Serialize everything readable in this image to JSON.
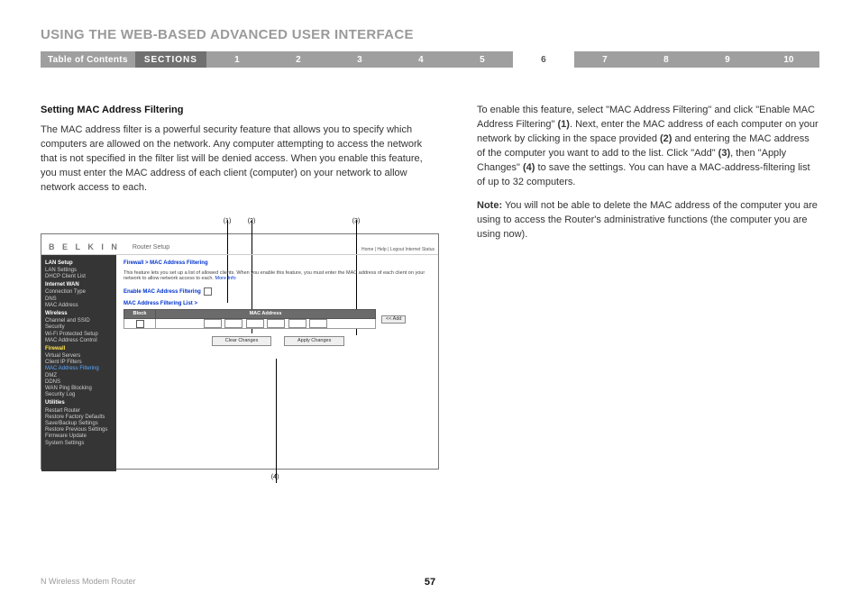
{
  "title": "USING THE WEB-BASED ADVANCED USER INTERFACE",
  "bar": {
    "toc": "Table of Contents",
    "sections": "SECTIONS",
    "nums": [
      "1",
      "2",
      "3",
      "4",
      "5",
      "6",
      "7",
      "8",
      "9",
      "10"
    ],
    "active": "6"
  },
  "left": {
    "heading": "Setting MAC Address Filtering",
    "p1": "The MAC address filter is a powerful security feature that allows you to specify which computers are allowed on the network. Any computer attempting to access the network that is not specified in the filter list will be denied access. When you enable this feature, you must enter the MAC address of each client (computer) on your network to allow network access to each."
  },
  "right": {
    "p1a": "To enable this feature, select \"MAC Address Filtering\" and click \"Enable MAC Address Filtering\" ",
    "b1": "(1)",
    "p1b": ". Next, enter the MAC address of each computer on your network by clicking in the space provided ",
    "b2": "(2)",
    "p1c": " and entering the MAC address of the computer you want to add to the list. Click \"Add\" ",
    "b3": "(3)",
    "p1d": ", then \"Apply Changes\" ",
    "b4": "(4)",
    "p1e": " to save the settings.  You can have a MAC-address-filtering list of up to 32 computers.",
    "noteLabel": "Note:",
    "note": " You will not be able to delete the MAC address of the computer you are using to access the Router's administrative functions (the computer you are using now)."
  },
  "callouts": {
    "c1": "(1)",
    "c2": "(2)",
    "c3": "(3)",
    "c4": "(4)"
  },
  "router": {
    "logo": "B E L K I N",
    "pageName": "Router Setup",
    "mini": "Home | Help | Logout   Internet Status",
    "side": {
      "g1": "LAN Setup",
      "i1": "LAN Settings",
      "i2": "DHCP Client List",
      "g2": "Internet WAN",
      "i3": "Connection Type",
      "i4": "DNS",
      "i5": "MAC Address",
      "g3": "Wireless",
      "i6": "Channel and SSID",
      "i7": "Security",
      "i8": "Wi-Fi Protected Setup",
      "i9": "MAC Address Control",
      "g4": "Firewall",
      "i10": "Virtual Servers",
      "i11": "Client IP Filters",
      "i12": "MAC Address Filtering",
      "i13": "DMZ",
      "i14": "DDNS",
      "i15": "WAN Ping Blocking",
      "i16": "Security Log",
      "g5": "Utilities",
      "i17": "Restart Router",
      "i18": "Restore Factory Defaults",
      "i19": "Save/Backup Settings",
      "i20": "Restore Previous Settings",
      "i21": "Firmware Update",
      "i22": "System Settings"
    },
    "crumb": "Firewall > MAC Address Filtering",
    "desc": "This feature lets you set up a list of allowed clients. When you enable this feature, you must enter the MAC address of each client on your network to allow network access to each. ",
    "more": "More Info",
    "enable": "Enable MAC Address Filtering",
    "listLabel": "MAC Address Filtering List >",
    "thBlock": "Block",
    "thMac": "MAC Address",
    "add": "<< Add",
    "clear": "Clear Changes",
    "apply": "Apply Changes"
  },
  "footer": {
    "product": "N Wireless Modem Router",
    "page": "57"
  }
}
